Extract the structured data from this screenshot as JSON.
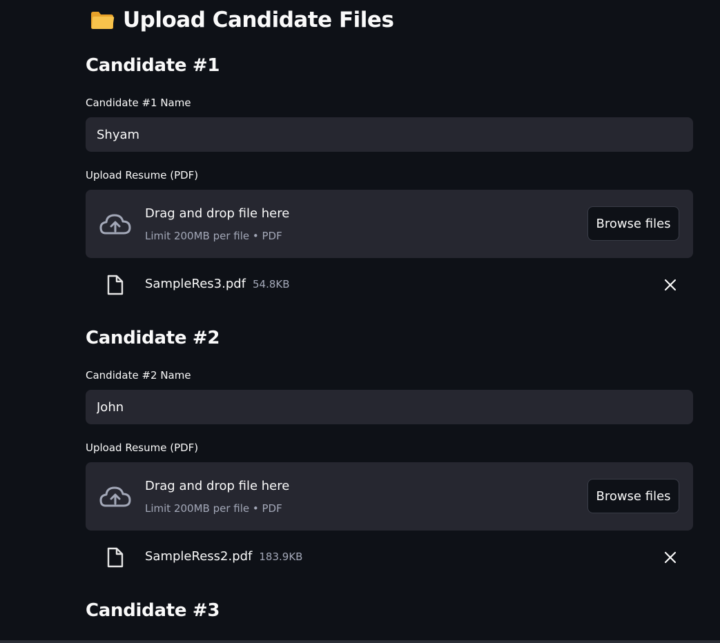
{
  "header": {
    "title": "Upload Candidate Files",
    "icon": "folder-icon"
  },
  "candidates": [
    {
      "heading": "Candidate #1",
      "name_label": "Candidate #1 Name",
      "name_value": "Shyam",
      "upload_label": "Upload Resume (PDF)",
      "dropzone": {
        "title": "Drag and drop file here",
        "subtitle": "Limit 200MB per file • PDF",
        "button": "Browse files"
      },
      "file": {
        "name": "SampleRes3.pdf",
        "size": "54.8KB"
      }
    },
    {
      "heading": "Candidate #2",
      "name_label": "Candidate #2 Name",
      "name_value": "John",
      "upload_label": "Upload Resume (PDF)",
      "dropzone": {
        "title": "Drag and drop file here",
        "subtitle": "Limit 200MB per file • PDF",
        "button": "Browse files"
      },
      "file": {
        "name": "SampleRess2.pdf",
        "size": "183.9KB"
      }
    },
    {
      "heading": "Candidate #3"
    }
  ],
  "colors": {
    "background": "#0e1117",
    "surface": "#262730",
    "text": "#fafafa",
    "muted": "#a3a8b8",
    "folder": "#f5b83d"
  }
}
